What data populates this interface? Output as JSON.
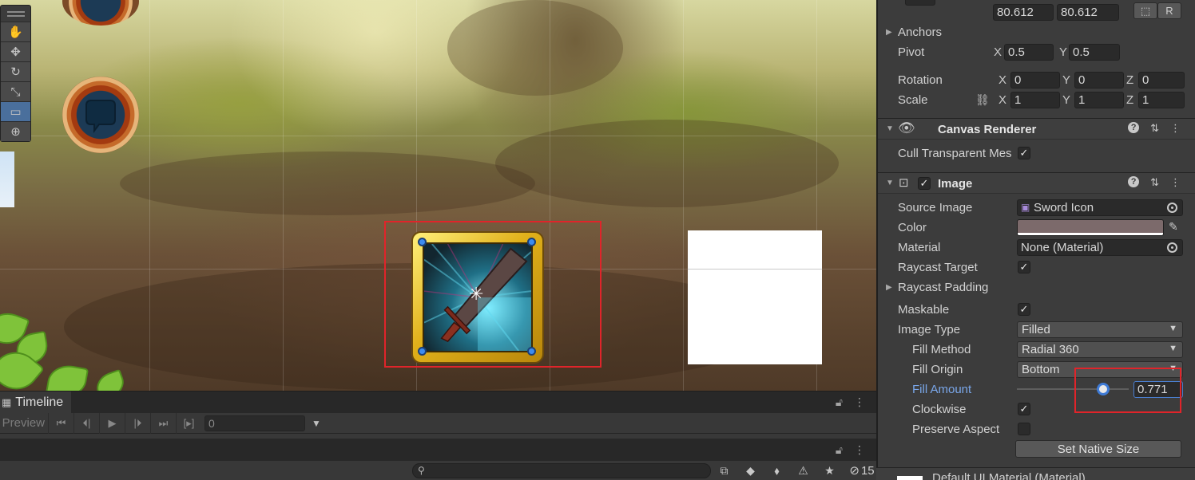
{
  "scene": {
    "tools": [
      "hand-tool",
      "move-tool",
      "rotate-tool",
      "scale-tool",
      "rect-tool",
      "transform-tool"
    ],
    "active_tool": "rect-tool"
  },
  "timeline": {
    "tab_label": "Timeline",
    "preview_label": "Preview",
    "frame_value": "0"
  },
  "console": {
    "count": "15"
  },
  "inspector": {
    "size": {
      "width": "80.612",
      "height": "80.612"
    },
    "anchors_label": "Anchors",
    "pivot": {
      "label": "Pivot",
      "x_axis": "X",
      "x": "0.5",
      "y_axis": "Y",
      "y": "0.5"
    },
    "rotation": {
      "label": "Rotation",
      "x": "0",
      "y": "0",
      "z": "0"
    },
    "scale": {
      "label": "Scale",
      "x": "1",
      "y": "1",
      "z": "1"
    },
    "axis_labels": {
      "x": "X",
      "y": "Y",
      "z": "Z"
    },
    "raw_button": "R",
    "canvas_renderer": {
      "title": "Canvas Renderer",
      "cull_label": "Cull Transparent Mes",
      "cull_checked": true
    },
    "image": {
      "title": "Image",
      "enabled": true,
      "source_image_label": "Source Image",
      "source_image_value": "Sword Icon",
      "color_label": "Color",
      "color_value": "#7c6a6b",
      "material_label": "Material",
      "material_value": "None (Material)",
      "raycast_target_label": "Raycast Target",
      "raycast_target": true,
      "raycast_padding_label": "Raycast Padding",
      "maskable_label": "Maskable",
      "maskable": true,
      "image_type_label": "Image Type",
      "image_type_value": "Filled",
      "fill_method_label": "Fill Method",
      "fill_method_value": "Radial 360",
      "fill_origin_label": "Fill Origin",
      "fill_origin_value": "Bottom",
      "fill_amount_label": "Fill Amount",
      "fill_amount_value": "0.771",
      "fill_amount": 0.771,
      "clockwise_label": "Clockwise",
      "clockwise": true,
      "preserve_aspect_label": "Preserve Aspect",
      "preserve_aspect": false,
      "set_native_size_label": "Set Native Size"
    },
    "material_footer": "Default UI Material (Material)"
  }
}
